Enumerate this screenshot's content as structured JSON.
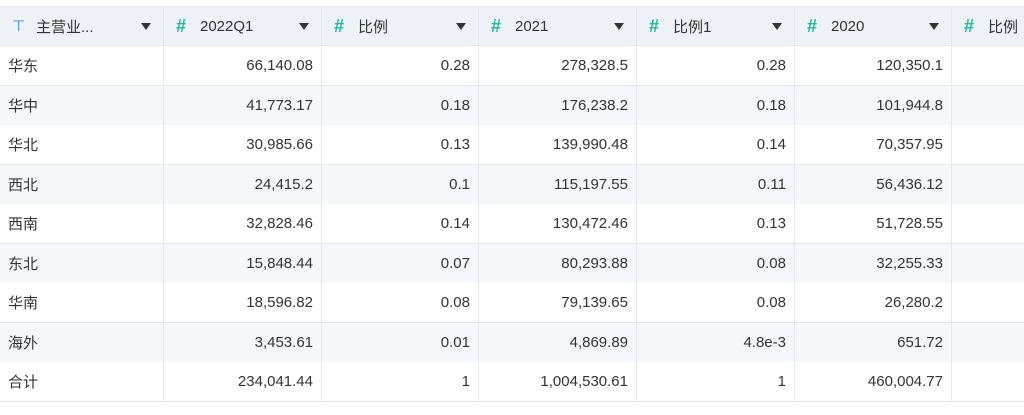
{
  "columns": [
    {
      "icon": "text-icon",
      "glyph": "⊤",
      "label": "主营业..."
    },
    {
      "icon": "number-icon",
      "glyph": "#",
      "label": "2022Q1"
    },
    {
      "icon": "number-icon",
      "glyph": "#",
      "label": "比例"
    },
    {
      "icon": "number-icon",
      "glyph": "#",
      "label": "2021"
    },
    {
      "icon": "number-icon",
      "glyph": "#",
      "label": "比例1"
    },
    {
      "icon": "number-icon",
      "glyph": "#",
      "label": "2020"
    },
    {
      "icon": "number-icon",
      "glyph": "#",
      "label": "比例"
    }
  ],
  "rows": [
    [
      "华东",
      "66,140.08",
      "0.28",
      "278,328.5",
      "0.28",
      "120,350.1",
      ""
    ],
    [
      "华中",
      "41,773.17",
      "0.18",
      "176,238.2",
      "0.18",
      "101,944.8",
      ""
    ],
    [
      "华北",
      "30,985.66",
      "0.13",
      "139,990.48",
      "0.14",
      "70,357.95",
      ""
    ],
    [
      "西北",
      "24,415.2",
      "0.1",
      "115,197.55",
      "0.11",
      "56,436.12",
      ""
    ],
    [
      "西南",
      "32,828.46",
      "0.14",
      "130,472.46",
      "0.13",
      "51,728.55",
      ""
    ],
    [
      "东北",
      "15,848.44",
      "0.07",
      "80,293.88",
      "0.08",
      "32,255.33",
      ""
    ],
    [
      "华南",
      "18,596.82",
      "0.08",
      "79,139.65",
      "0.08",
      "26,280.2",
      ""
    ],
    [
      "海外",
      "3,453.61",
      "0.01",
      "4,869.89",
      "4.8e-3",
      "651.72",
      ""
    ],
    [
      "合计",
      "234,041.44",
      "1",
      "1,004,530.61",
      "1",
      "460,004.77",
      ""
    ]
  ],
  "colors": {
    "header_bg": "#eef1f6",
    "alt_row_bg": "#f5f7fa",
    "text_icon": "#3b82f6",
    "number_icon": "#24b8a0"
  }
}
